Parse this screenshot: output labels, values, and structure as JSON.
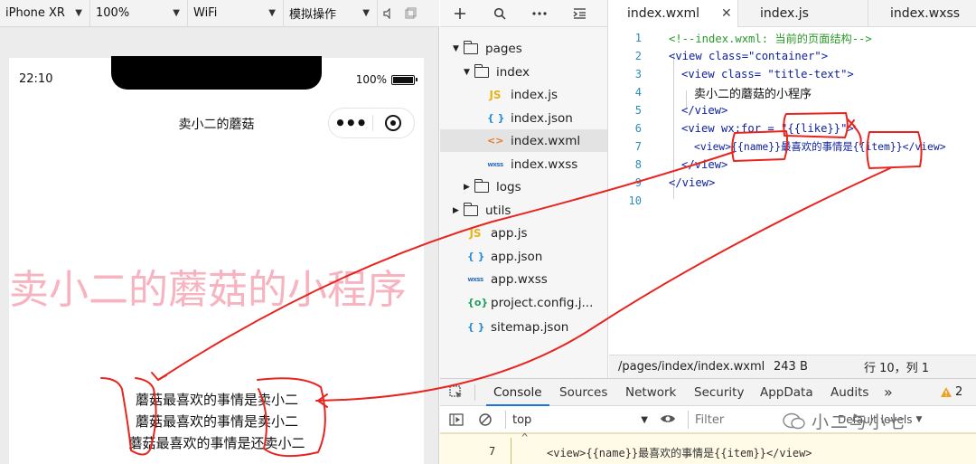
{
  "simulator": {
    "device": "iPhone XR",
    "zoom": "100%",
    "network": "WiFi",
    "operation": "模拟操作",
    "status_time": "22:10",
    "battery": "100%",
    "nav_title": "卖小二的蘑菇",
    "page_title_text": "卖小二的蘑菇的小程序",
    "list_items": [
      "蘑菇最喜欢的事情是卖小二",
      "蘑菇最喜欢的事情是卖小二",
      "蘑菇最喜欢的事情是还卖小二"
    ]
  },
  "file_tree": {
    "items": [
      {
        "label": "pages",
        "type": "folder",
        "expanded": true
      },
      {
        "label": "index",
        "type": "folder",
        "expanded": true
      },
      {
        "label": "index.js",
        "type": "js"
      },
      {
        "label": "index.json",
        "type": "json"
      },
      {
        "label": "index.wxml",
        "type": "wxml",
        "selected": true
      },
      {
        "label": "index.wxss",
        "type": "wxss"
      },
      {
        "label": "logs",
        "type": "folder",
        "expanded": false
      },
      {
        "label": "utils",
        "type": "folder",
        "expanded": false
      },
      {
        "label": "app.js",
        "type": "js"
      },
      {
        "label": "app.json",
        "type": "json"
      },
      {
        "label": "app.wxss",
        "type": "wxss"
      },
      {
        "label": "project.config.j...",
        "type": "config"
      },
      {
        "label": "sitemap.json",
        "type": "json"
      }
    ]
  },
  "editor": {
    "tabs": [
      "index.wxml",
      "index.js",
      "index.wxss"
    ],
    "active_tab": "index.wxml",
    "lines": [
      {
        "n": "1",
        "code": "<!--index.wxml: 当前的页面结构-->"
      },
      {
        "n": "2",
        "code": "<view class=\"container\">"
      },
      {
        "n": "3",
        "code": "<view class= \"title-text\">"
      },
      {
        "n": "4",
        "code": "卖小二的蘑菇的小程序"
      },
      {
        "n": "5",
        "code": "</view>"
      },
      {
        "n": "6",
        "code": "<view wx:for = \"{{like}}\">"
      },
      {
        "n": "7",
        "code": "<view>{{name}}最喜欢的事情是{{item}}</view>"
      },
      {
        "n": "8",
        "code": "</view>"
      },
      {
        "n": "9",
        "code": "</view>"
      },
      {
        "n": "10",
        "code": ""
      }
    ],
    "status_path": "/pages/index/index.wxml",
    "status_size": "243 B",
    "status_pos": "行 10，列 1"
  },
  "devtools": {
    "tabs": [
      "Console",
      "Sources",
      "Network",
      "Security",
      "AppData",
      "Audits"
    ],
    "active_tab": "Console",
    "more": "»",
    "warn_count": "2",
    "context": "top",
    "filter_placeholder": "Filter",
    "levels": "Default levels",
    "console_caret": "^",
    "console_line_no": "7",
    "console_line": "<view>{{name}}最喜欢的事情是{{item}}</view>"
  },
  "watermark": "小二与小七",
  "icons": {
    "add": "plus-icon",
    "search": "search-icon",
    "more": "more-icon",
    "collapse": "collapse-icon"
  }
}
